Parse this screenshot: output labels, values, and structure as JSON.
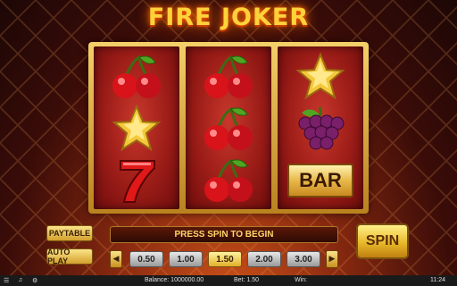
{
  "game": {
    "title": "FIRE JOKER"
  },
  "reels": [
    [
      "cherry",
      "star",
      "seven"
    ],
    [
      "cherry",
      "cherry",
      "cherry"
    ],
    [
      "star",
      "grapes",
      "bar"
    ]
  ],
  "symbols": {
    "bar_label": "BAR"
  },
  "buttons": {
    "paytable": "PAYTABLE",
    "autoplay": "AUTO PLAY",
    "spin": "SPIN"
  },
  "message": "PRESS SPIN TO BEGIN",
  "bets": {
    "options": [
      "0.50",
      "1.00",
      "1.50",
      "2.00",
      "3.00"
    ],
    "selected": "1.50"
  },
  "status": {
    "balance": "Balance: 1000000.00",
    "bet": "Bet: 1.50",
    "win": "Win:",
    "time": "11:24"
  },
  "colors": {
    "accent": "#ffd23a",
    "reel_red": "#9b1c17",
    "gold": "#e8b84a"
  }
}
